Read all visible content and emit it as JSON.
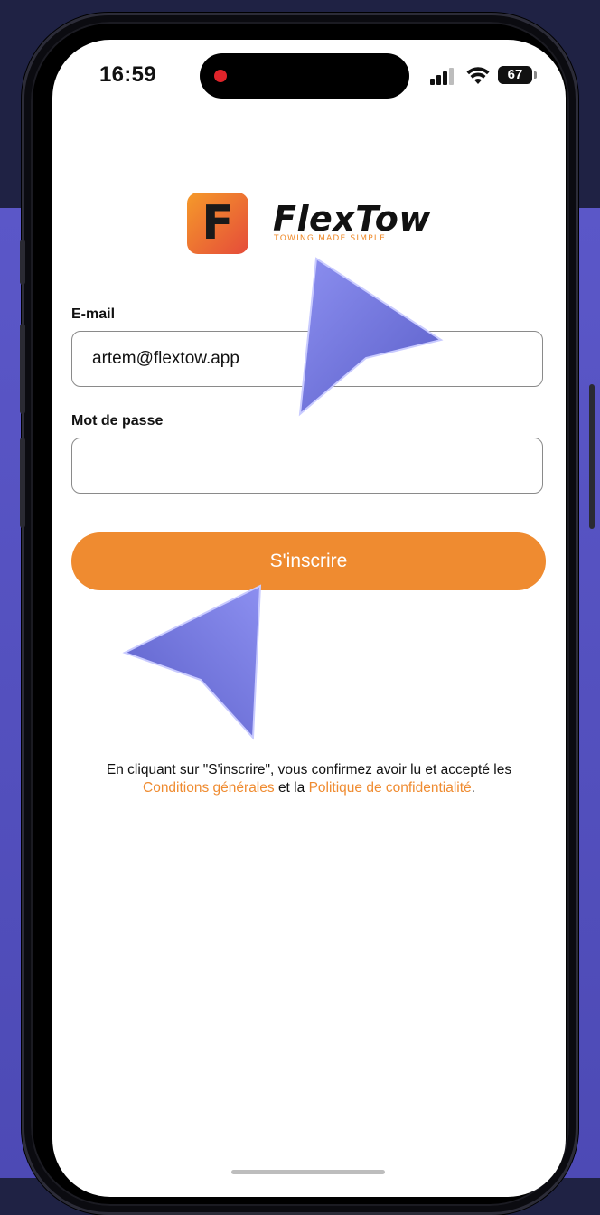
{
  "status_bar": {
    "time": "16:59",
    "battery": "67"
  },
  "brand": {
    "name": "FlexTow",
    "tagline": "TOWING MADE SIMPLE",
    "icon_letter": "F"
  },
  "form": {
    "email_label": "E-mail",
    "email_value": "artem@flextow.app",
    "password_label": "Mot de passe",
    "password_value": "",
    "submit_label": "S'inscrire"
  },
  "legal": {
    "prefix": "En cliquant sur \"S'inscrire\", vous confirmez avoir lu et accepté les",
    "terms_link": "Conditions générales",
    "middle": "et la",
    "privacy_link": "Politique de confidentialité",
    "suffix": "."
  },
  "colors": {
    "accent": "#ef8b30",
    "background_top": "#1f2244",
    "background_bottom": "#5a55c4",
    "cursor": "#6b6fd6"
  },
  "icons": [
    "signal-icon",
    "wifi-icon",
    "battery-icon",
    "pointer-cursor-icon"
  ]
}
